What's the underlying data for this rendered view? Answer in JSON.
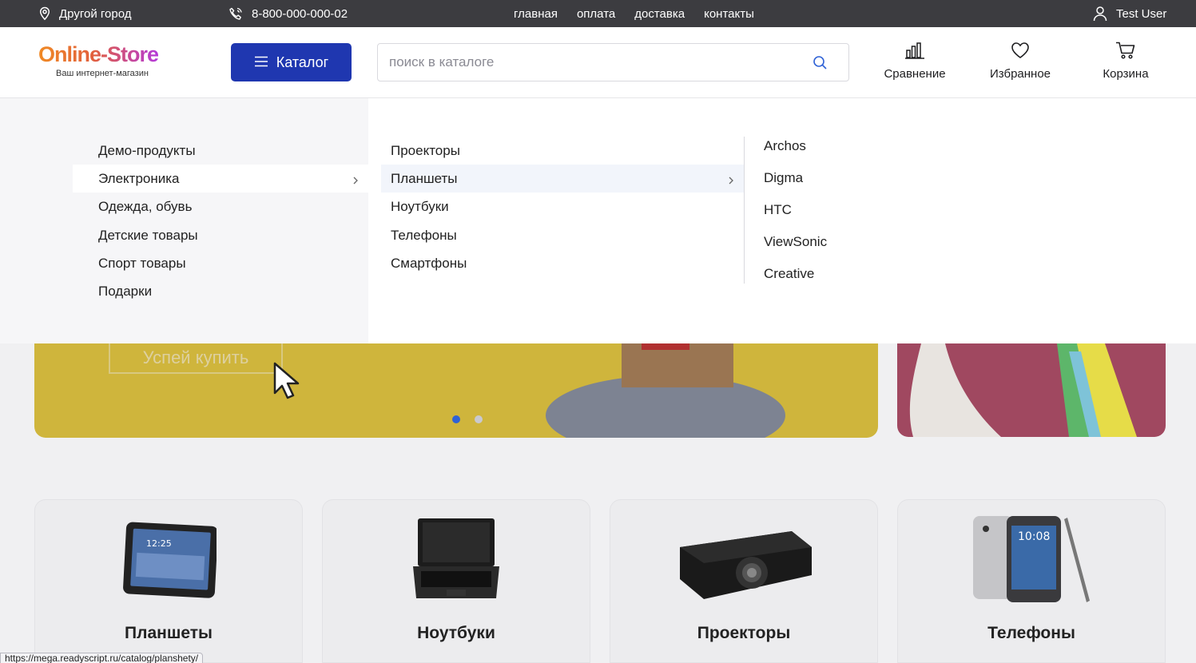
{
  "topbar": {
    "city": "Другой город",
    "phone": "8-800-000-000-02",
    "nav": [
      "главная",
      "оплата",
      "доставка",
      "контакты"
    ],
    "user": "Test User"
  },
  "header": {
    "logo_main": "Online-Store",
    "logo_sub": "Ваш интернет-магазин",
    "catalog_label": "Каталог",
    "search_placeholder": "поиск в каталоге",
    "compare_label": "Сравнение",
    "favorites_label": "Избранное",
    "cart_label": "Корзина"
  },
  "mega_menu": {
    "level1": [
      "Демо-продукты",
      "Электроника",
      "Одежда, обувь",
      "Детские товары",
      "Спорт товары",
      "Подарки"
    ],
    "level1_active": "Электроника",
    "level2": [
      "Проекторы",
      "Планшеты",
      "Ноутбуки",
      "Телефоны",
      "Смартфоны"
    ],
    "level2_active": "Планшеты",
    "level3": [
      "Archos",
      "Digma",
      "HTC",
      "ViewSonic",
      "Creative"
    ]
  },
  "banner": {
    "button_label": "Успей купить",
    "slides_total": 2,
    "active_slide": 1
  },
  "categories": [
    "Планшеты",
    "Ноутбуки",
    "Проекторы",
    "Телефоны"
  ],
  "status_bar_url": "https://mega.readyscript.ru/catalog/planshety/",
  "colors": {
    "topbar_bg": "#3c3c40",
    "catalog_button": "#1f37b0",
    "banner_yellow": "#cfb53c",
    "banner_pink": "#a04860"
  }
}
